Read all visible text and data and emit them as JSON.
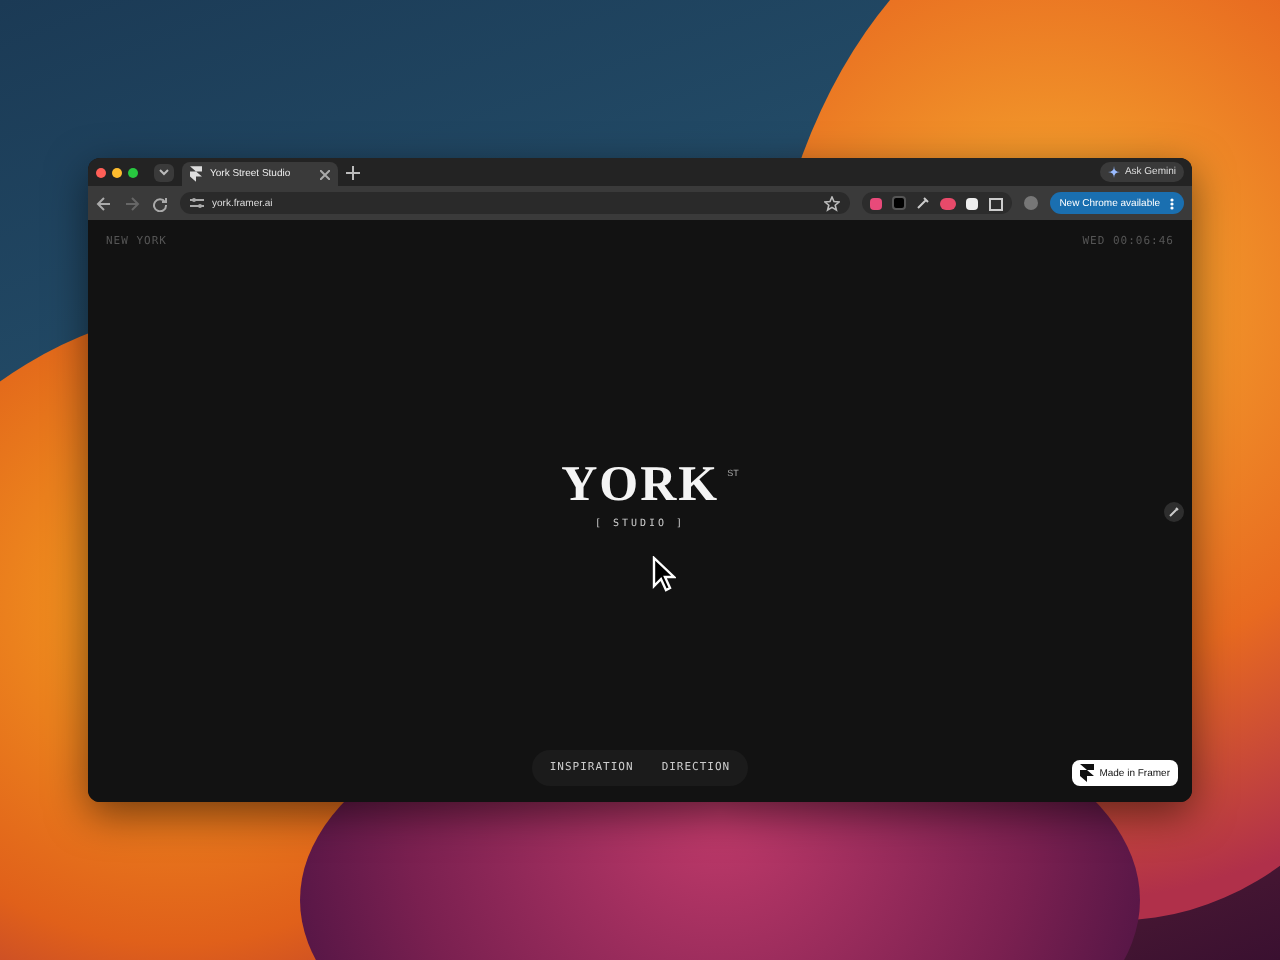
{
  "browser": {
    "tabs": [
      {
        "title": "York Street Studio",
        "selected": true
      }
    ],
    "address": "york.framer.ai",
    "ask_button": "Ask Gemini",
    "update_button": "New Chrome available"
  },
  "page": {
    "location": "NEW YORK",
    "clock": "WED 00:06:46",
    "logo": "YORK",
    "logo_sup": "ST",
    "subtitle": "[ STUDIO ]",
    "nav": [
      "INSPIRATION",
      "DIRECTION"
    ],
    "badge": "Made in Framer"
  }
}
